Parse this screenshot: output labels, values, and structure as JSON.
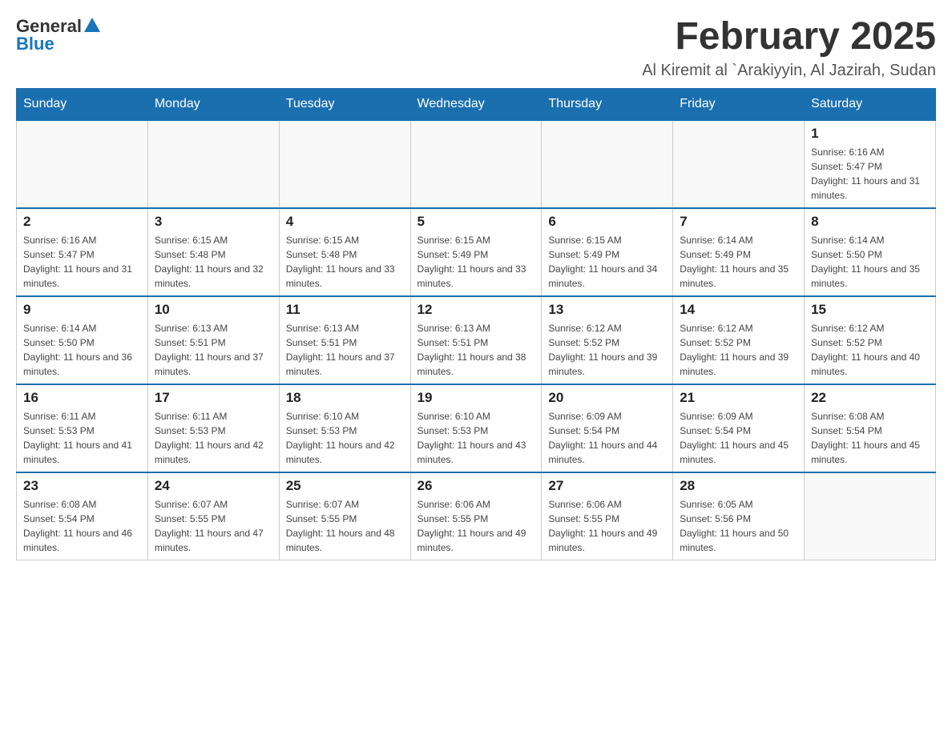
{
  "header": {
    "logo_general": "General",
    "logo_blue": "Blue",
    "month_title": "February 2025",
    "location": "Al Kiremit al `Arakiyyin, Al Jazirah, Sudan"
  },
  "days_of_week": [
    "Sunday",
    "Monday",
    "Tuesday",
    "Wednesday",
    "Thursday",
    "Friday",
    "Saturday"
  ],
  "weeks": [
    [
      {
        "day": "",
        "info": ""
      },
      {
        "day": "",
        "info": ""
      },
      {
        "day": "",
        "info": ""
      },
      {
        "day": "",
        "info": ""
      },
      {
        "day": "",
        "info": ""
      },
      {
        "day": "",
        "info": ""
      },
      {
        "day": "1",
        "info": "Sunrise: 6:16 AM\nSunset: 5:47 PM\nDaylight: 11 hours and 31 minutes."
      }
    ],
    [
      {
        "day": "2",
        "info": "Sunrise: 6:16 AM\nSunset: 5:47 PM\nDaylight: 11 hours and 31 minutes."
      },
      {
        "day": "3",
        "info": "Sunrise: 6:15 AM\nSunset: 5:48 PM\nDaylight: 11 hours and 32 minutes."
      },
      {
        "day": "4",
        "info": "Sunrise: 6:15 AM\nSunset: 5:48 PM\nDaylight: 11 hours and 33 minutes."
      },
      {
        "day": "5",
        "info": "Sunrise: 6:15 AM\nSunset: 5:49 PM\nDaylight: 11 hours and 33 minutes."
      },
      {
        "day": "6",
        "info": "Sunrise: 6:15 AM\nSunset: 5:49 PM\nDaylight: 11 hours and 34 minutes."
      },
      {
        "day": "7",
        "info": "Sunrise: 6:14 AM\nSunset: 5:49 PM\nDaylight: 11 hours and 35 minutes."
      },
      {
        "day": "8",
        "info": "Sunrise: 6:14 AM\nSunset: 5:50 PM\nDaylight: 11 hours and 35 minutes."
      }
    ],
    [
      {
        "day": "9",
        "info": "Sunrise: 6:14 AM\nSunset: 5:50 PM\nDaylight: 11 hours and 36 minutes."
      },
      {
        "day": "10",
        "info": "Sunrise: 6:13 AM\nSunset: 5:51 PM\nDaylight: 11 hours and 37 minutes."
      },
      {
        "day": "11",
        "info": "Sunrise: 6:13 AM\nSunset: 5:51 PM\nDaylight: 11 hours and 37 minutes."
      },
      {
        "day": "12",
        "info": "Sunrise: 6:13 AM\nSunset: 5:51 PM\nDaylight: 11 hours and 38 minutes."
      },
      {
        "day": "13",
        "info": "Sunrise: 6:12 AM\nSunset: 5:52 PM\nDaylight: 11 hours and 39 minutes."
      },
      {
        "day": "14",
        "info": "Sunrise: 6:12 AM\nSunset: 5:52 PM\nDaylight: 11 hours and 39 minutes."
      },
      {
        "day": "15",
        "info": "Sunrise: 6:12 AM\nSunset: 5:52 PM\nDaylight: 11 hours and 40 minutes."
      }
    ],
    [
      {
        "day": "16",
        "info": "Sunrise: 6:11 AM\nSunset: 5:53 PM\nDaylight: 11 hours and 41 minutes."
      },
      {
        "day": "17",
        "info": "Sunrise: 6:11 AM\nSunset: 5:53 PM\nDaylight: 11 hours and 42 minutes."
      },
      {
        "day": "18",
        "info": "Sunrise: 6:10 AM\nSunset: 5:53 PM\nDaylight: 11 hours and 42 minutes."
      },
      {
        "day": "19",
        "info": "Sunrise: 6:10 AM\nSunset: 5:53 PM\nDaylight: 11 hours and 43 minutes."
      },
      {
        "day": "20",
        "info": "Sunrise: 6:09 AM\nSunset: 5:54 PM\nDaylight: 11 hours and 44 minutes."
      },
      {
        "day": "21",
        "info": "Sunrise: 6:09 AM\nSunset: 5:54 PM\nDaylight: 11 hours and 45 minutes."
      },
      {
        "day": "22",
        "info": "Sunrise: 6:08 AM\nSunset: 5:54 PM\nDaylight: 11 hours and 45 minutes."
      }
    ],
    [
      {
        "day": "23",
        "info": "Sunrise: 6:08 AM\nSunset: 5:54 PM\nDaylight: 11 hours and 46 minutes."
      },
      {
        "day": "24",
        "info": "Sunrise: 6:07 AM\nSunset: 5:55 PM\nDaylight: 11 hours and 47 minutes."
      },
      {
        "day": "25",
        "info": "Sunrise: 6:07 AM\nSunset: 5:55 PM\nDaylight: 11 hours and 48 minutes."
      },
      {
        "day": "26",
        "info": "Sunrise: 6:06 AM\nSunset: 5:55 PM\nDaylight: 11 hours and 49 minutes."
      },
      {
        "day": "27",
        "info": "Sunrise: 6:06 AM\nSunset: 5:55 PM\nDaylight: 11 hours and 49 minutes."
      },
      {
        "day": "28",
        "info": "Sunrise: 6:05 AM\nSunset: 5:56 PM\nDaylight: 11 hours and 50 minutes."
      },
      {
        "day": "",
        "info": ""
      }
    ]
  ]
}
